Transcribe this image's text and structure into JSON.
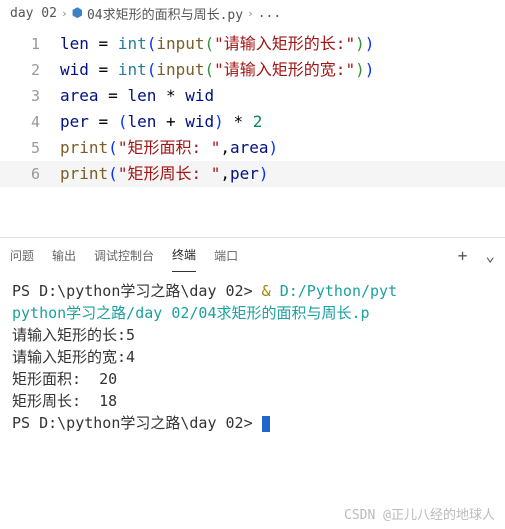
{
  "breadcrumb": {
    "folder": "day 02",
    "file": "04求矩形的面积与周长.py",
    "more": "..."
  },
  "editor": {
    "lines": [
      {
        "n": "1",
        "tokens": [
          {
            "c": "t-var",
            "t": "len"
          },
          {
            "c": "t-op",
            "t": " = "
          },
          {
            "c": "t-call",
            "t": "int"
          },
          {
            "c": "t-pn",
            "t": "("
          },
          {
            "c": "t-fn",
            "t": "input"
          },
          {
            "c": "t-pn2",
            "t": "("
          },
          {
            "c": "t-str",
            "t": "\"请输入矩形的长:\""
          },
          {
            "c": "t-pn2",
            "t": ")"
          },
          {
            "c": "t-pn",
            "t": ")"
          }
        ]
      },
      {
        "n": "2",
        "tokens": [
          {
            "c": "t-var",
            "t": "wid"
          },
          {
            "c": "t-op",
            "t": " = "
          },
          {
            "c": "t-call",
            "t": "int"
          },
          {
            "c": "t-pn",
            "t": "("
          },
          {
            "c": "t-fn",
            "t": "input"
          },
          {
            "c": "t-pn2",
            "t": "("
          },
          {
            "c": "t-str",
            "t": "\"请输入矩形的宽:\""
          },
          {
            "c": "t-pn2",
            "t": ")"
          },
          {
            "c": "t-pn",
            "t": ")"
          }
        ]
      },
      {
        "n": "3",
        "tokens": [
          {
            "c": "t-var",
            "t": "area"
          },
          {
            "c": "t-op",
            "t": " = "
          },
          {
            "c": "t-var",
            "t": "len"
          },
          {
            "c": "t-op",
            "t": " * "
          },
          {
            "c": "t-var",
            "t": "wid"
          }
        ]
      },
      {
        "n": "4",
        "tokens": [
          {
            "c": "t-var",
            "t": "per"
          },
          {
            "c": "t-op",
            "t": " = "
          },
          {
            "c": "t-pn",
            "t": "("
          },
          {
            "c": "t-var",
            "t": "len"
          },
          {
            "c": "t-op",
            "t": " + "
          },
          {
            "c": "t-var",
            "t": "wid"
          },
          {
            "c": "t-pn",
            "t": ")"
          },
          {
            "c": "t-op",
            "t": " * "
          },
          {
            "c": "t-num",
            "t": "2"
          }
        ]
      },
      {
        "n": "5",
        "tokens": [
          {
            "c": "t-fn",
            "t": "print"
          },
          {
            "c": "t-pn",
            "t": "("
          },
          {
            "c": "t-str",
            "t": "\"矩形面积: \""
          },
          {
            "c": "t-op",
            "t": ","
          },
          {
            "c": "t-var",
            "t": "area"
          },
          {
            "c": "t-pn",
            "t": ")"
          }
        ]
      },
      {
        "n": "6",
        "current": true,
        "tokens": [
          {
            "c": "t-fn",
            "t": "print"
          },
          {
            "c": "t-pn",
            "t": "("
          },
          {
            "c": "t-str",
            "t": "\"矩形周长: \""
          },
          {
            "c": "t-op",
            "t": ","
          },
          {
            "c": "t-var",
            "t": "per"
          },
          {
            "c": "t-pn",
            "t": ")"
          }
        ]
      }
    ]
  },
  "panel": {
    "tabs": {
      "problems": "问题",
      "output": "输出",
      "debug": "调试控制台",
      "terminal": "终端",
      "ports": "端口"
    },
    "active": "terminal",
    "plus": "+",
    "chev": "⌄"
  },
  "terminal": {
    "l1a": "PS D:\\python学习之路\\day 02> ",
    "l1b": "& ",
    "l1c": "D:/Python/pyt",
    "l2": "python学习之路/day 02/04求矩形的面积与周长.p",
    "l3": "请输入矩形的长:5",
    "l4": "请输入矩形的宽:4",
    "l5": "矩形面积:  20",
    "l6": "矩形周长:  18",
    "l7": "PS D:\\python学习之路\\day 02> "
  },
  "watermark": "CSDN @正儿八经的地球人"
}
